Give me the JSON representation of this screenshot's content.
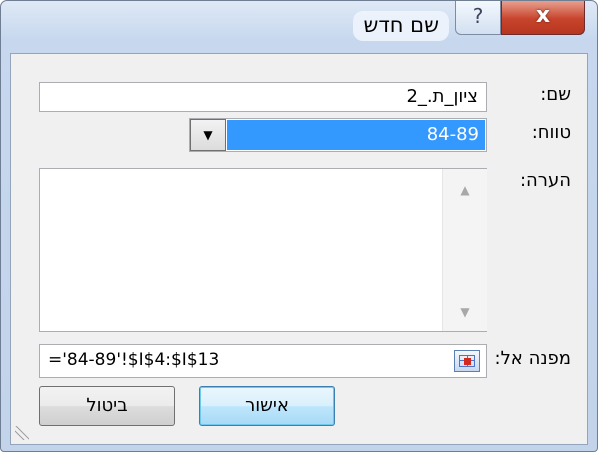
{
  "window": {
    "title": "שם חדש",
    "help_icon": "?",
    "close_icon": "x"
  },
  "form": {
    "name_label": "שם:",
    "name_value": "ציון_ת._2",
    "range_label": "טווח:",
    "range_value": "84-89",
    "comment_label": "הערה:",
    "comment_value": "",
    "refers_label": "מפנה אל:",
    "refers_value": "='84-89'!$I$4:$I$13"
  },
  "buttons": {
    "ok_label": "אישור",
    "cancel_label": "ביטול"
  },
  "icons": {
    "help": "question-icon",
    "close": "close-icon",
    "dropdown": "chevron-down-icon",
    "collapse": "collapse-dialog-icon",
    "scroll_up": "scroll-up-arrow-icon",
    "scroll_down": "scroll-down-arrow-icon",
    "resize": "resize-grip-icon"
  },
  "colors": {
    "selection": "#3399ff",
    "close_button": "#c7432c",
    "default_button_border": "#3c7fb1"
  }
}
